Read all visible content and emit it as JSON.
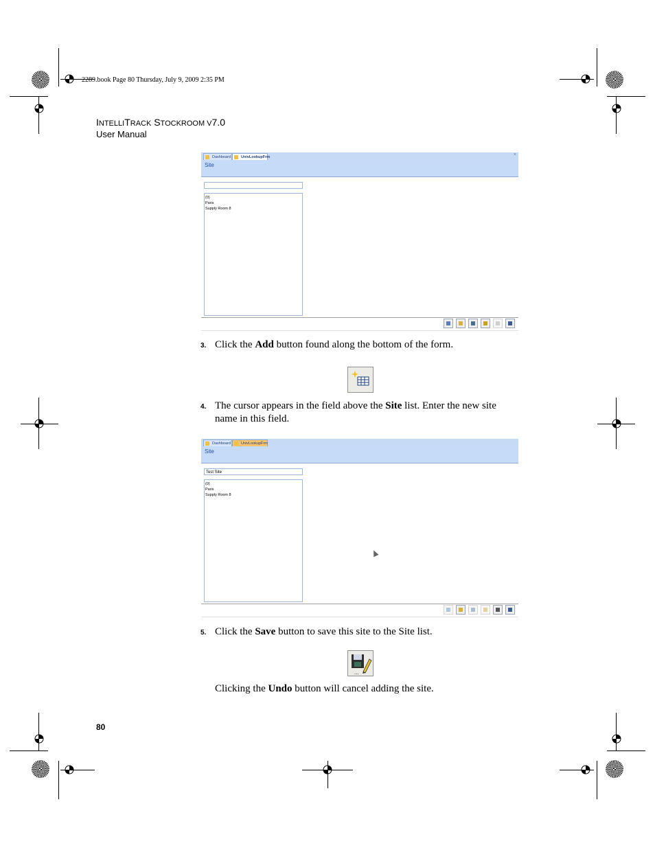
{
  "slug": "2289.book  Page 80  Thursday, July 9, 2009  2:35 PM",
  "header": {
    "title_a": "I",
    "title_b": "NTELLI",
    "title_c": "T",
    "title_d": "RACK",
    "title_e": " S",
    "title_f": "TOCKROOM",
    "title_g": " V",
    "title_h": "7.0",
    "subtitle": "User Manual"
  },
  "screenshot1": {
    "tabs": [
      "Dashboard",
      "UnivLookupFrm"
    ],
    "form_title": "Site",
    "field_value": "",
    "list_items": [
      "(0)",
      "Paris",
      "Supply Room 8"
    ]
  },
  "step3": {
    "num": "3.",
    "pre": "Click the ",
    "bold": "Add",
    "post": " button found along the bottom of the form."
  },
  "step4": {
    "num": "4.",
    "pre": "The cursor appears in the field above the ",
    "bold": "Site",
    "post": " list. Enter the new site name in this field."
  },
  "screenshot2": {
    "tabs": [
      "Dashboard",
      "UnivLookupFrm"
    ],
    "form_title": "Site",
    "field_value": "Test Site",
    "list_items": [
      "(0)",
      "Paris",
      "Supply Room 8"
    ]
  },
  "step5": {
    "num": "5.",
    "pre": "Click the ",
    "bold": "Save",
    "post": " button to save this site to the Site list."
  },
  "note": {
    "pre": "Clicking the ",
    "bold": "Undo",
    "post": " button will cancel adding the site."
  },
  "page_number": "80",
  "icons": {
    "add": "add-record-icon",
    "save": "save-icon",
    "toolbar": [
      "add-icon",
      "edit-icon",
      "save-icon",
      "delete-icon",
      "undo-icon",
      "exit-icon"
    ]
  }
}
